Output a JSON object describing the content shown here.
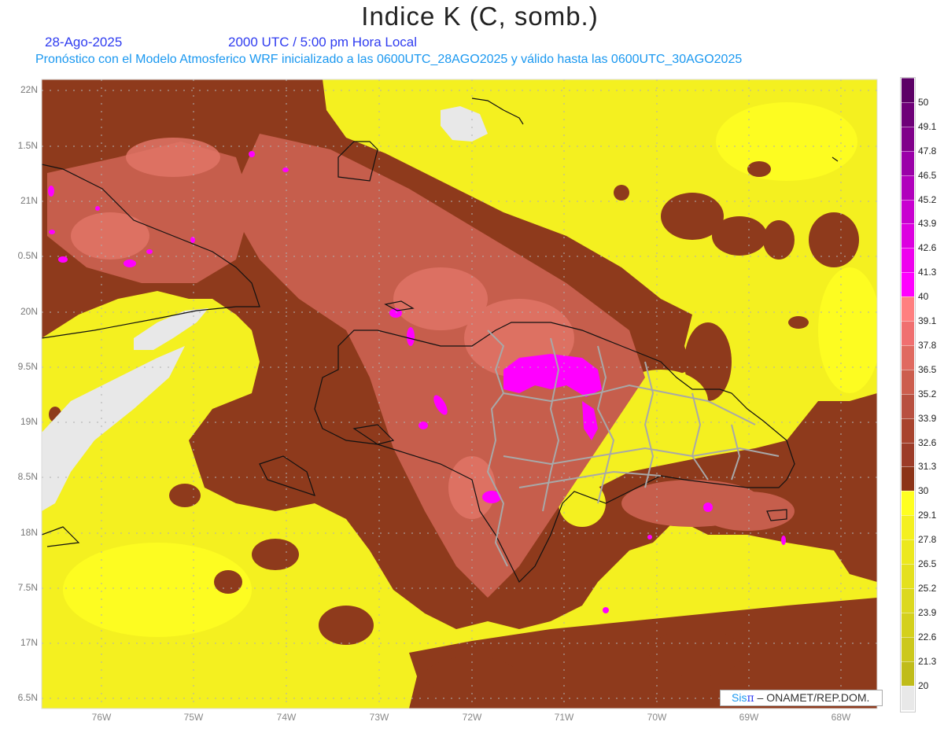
{
  "header": {
    "title": "Indice K (C, somb.)",
    "date": "28-Ago-2025",
    "time": "2000 UTC / 5:00 pm Hora Local",
    "forecast_note": "Pronóstico con el Modelo Atmosferico WRF inicializado a las 0600UTC_28AGO2025 y válido hasta las  0600UTC_30AGO2025"
  },
  "map": {
    "lat_labels": [
      "22N",
      "1.5N",
      "21N",
      "0.5N",
      "20N",
      "9.5N",
      "19N",
      "8.5N",
      "18N",
      "7.5N",
      "17N",
      "6.5N"
    ],
    "lon_labels": [
      "76W",
      "75W",
      "74W",
      "73W",
      "72W",
      "71W",
      "70W",
      "69W",
      "68W"
    ]
  },
  "colorbar": {
    "labels": [
      "50",
      "49.1",
      "47.8",
      "46.5",
      "45.2",
      "43.9",
      "42.6",
      "41.3",
      "40",
      "39.1",
      "37.8",
      "36.5",
      "35.2",
      "33.9",
      "32.6",
      "31.3",
      "30",
      "29.1",
      "27.8",
      "26.5",
      "25.2",
      "23.9",
      "22.6",
      "21.3",
      "20"
    ],
    "colors": [
      "#5c0066",
      "#6e0078",
      "#80008a",
      "#9a00a8",
      "#b000bc",
      "#c800d0",
      "#dc00e0",
      "#ee00ee",
      "#ff00ff",
      "#ff8080",
      "#f07070",
      "#e06a60",
      "#cc5e4e",
      "#b85040",
      "#a8442e",
      "#9c3c28",
      "#8c3418",
      "#ffff20",
      "#f4f020",
      "#ece81e",
      "#e4e01e",
      "#dcd81e",
      "#d4d01c",
      "#ccc81c",
      "#c0bc1a",
      "#e8e8e8"
    ]
  },
  "credit": {
    "logo_text": "Sis",
    "logo_symbol": "π",
    "org": " –  ONAMET/REP.DOM."
  }
}
